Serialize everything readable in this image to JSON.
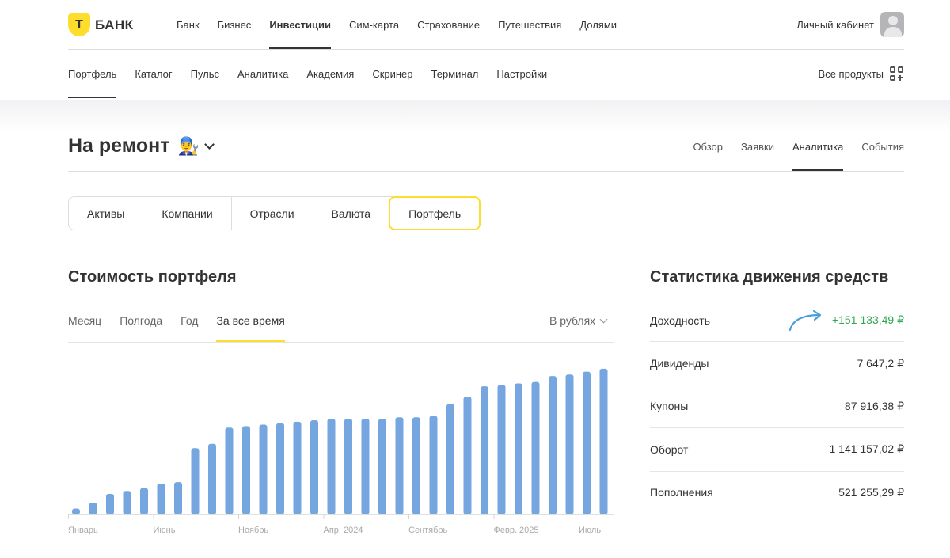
{
  "logo": {
    "mark": "Т",
    "text": "БАНК"
  },
  "top_nav": [
    {
      "label": "Банк",
      "active": false
    },
    {
      "label": "Бизнес",
      "active": false
    },
    {
      "label": "Инвестиции",
      "active": true
    },
    {
      "label": "Сим-карта",
      "active": false
    },
    {
      "label": "Страхование",
      "active": false
    },
    {
      "label": "Путешествия",
      "active": false
    },
    {
      "label": "Долями",
      "active": false
    }
  ],
  "cabinet_label": "Личный кабинет",
  "sub_nav": [
    {
      "label": "Портфель",
      "active": true
    },
    {
      "label": "Каталог",
      "active": false
    },
    {
      "label": "Пульс",
      "active": false
    },
    {
      "label": "Аналитика",
      "active": false
    },
    {
      "label": "Академия",
      "active": false
    },
    {
      "label": "Скринер",
      "active": false
    },
    {
      "label": "Терминал",
      "active": false
    },
    {
      "label": "Настройки",
      "active": false
    }
  ],
  "all_products_label": "Все продукты",
  "portfolio": {
    "name": "На ремонт",
    "emoji": "👨‍🔧"
  },
  "portfolio_tabs": [
    {
      "label": "Обзор",
      "active": false
    },
    {
      "label": "Заявки",
      "active": false
    },
    {
      "label": "Аналитика",
      "active": true
    },
    {
      "label": "События",
      "active": false
    }
  ],
  "segments": [
    {
      "label": "Активы",
      "active": false
    },
    {
      "label": "Компании",
      "active": false
    },
    {
      "label": "Отрасли",
      "active": false
    },
    {
      "label": "Валюта",
      "active": false
    },
    {
      "label": "Портфель",
      "active": true
    }
  ],
  "value_section_title": "Стоимость портфеля",
  "periods": [
    {
      "label": "Месяц",
      "active": false
    },
    {
      "label": "Полгода",
      "active": false
    },
    {
      "label": "Год",
      "active": false
    },
    {
      "label": "За все время",
      "active": true
    }
  ],
  "currency_label": "В рублях",
  "stats_title": "Статистика движения средств",
  "stats": [
    {
      "label": "Доходность",
      "value": "+151 133,49 ₽",
      "positive": true
    },
    {
      "label": "Дивиденды",
      "value": "7 647,2 ₽",
      "positive": false
    },
    {
      "label": "Купоны",
      "value": "87 916,38 ₽",
      "positive": false
    },
    {
      "label": "Оборот",
      "value": "1 141 157,02 ₽",
      "positive": false
    },
    {
      "label": "Пополнения",
      "value": "521 255,29 ₽",
      "positive": false
    }
  ],
  "colors": {
    "accent": "#ffdd2d",
    "bar": "#76a6e0",
    "positive": "#2fa84f"
  },
  "chart_data": {
    "type": "bar",
    "x_tick_labels": [
      "Январь",
      "Июнь",
      "Ноябрь",
      "Апр. 2024",
      "Сентябрь",
      "Февр. 2025",
      "Июль"
    ],
    "tick_positions": [
      0,
      5,
      10,
      15,
      20,
      25,
      30
    ],
    "values": [
      4,
      8,
      14,
      16,
      18,
      21,
      22,
      45,
      48,
      59,
      60,
      61,
      62,
      63,
      64,
      65,
      65,
      65,
      65,
      66,
      66,
      67,
      75,
      80,
      87,
      88,
      89,
      90,
      94,
      95,
      97,
      99,
      100
    ],
    "ylim": [
      0,
      100
    ],
    "grid": false
  }
}
